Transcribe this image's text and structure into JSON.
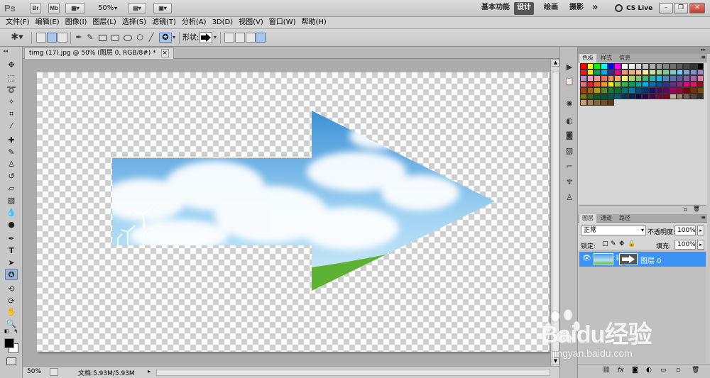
{
  "appbar": {
    "logo": "Ps",
    "br": "Br",
    "mb": "Mb",
    "zoom": "50%",
    "workspaces": [
      "基本功能",
      "设计",
      "绘画",
      "摄影"
    ],
    "active_workspace": "设计",
    "more": "»",
    "cslive": "CS Live"
  },
  "menu": [
    "文件(F)",
    "编辑(E)",
    "图像(I)",
    "图层(L)",
    "选择(S)",
    "滤镜(T)",
    "分析(A)",
    "3D(D)",
    "视图(V)",
    "窗口(W)",
    "帮助(H)"
  ],
  "options": {
    "shape_label": "形状:"
  },
  "document": {
    "tab_title": "timg (17).jpg @ 50% (图层 0, RGB/8#) *",
    "tab_close": "×"
  },
  "status": {
    "zoom": "50%",
    "doc_info": "文档:5.93M/5.93M"
  },
  "swatch_panel": {
    "tabs": [
      "色板",
      "样式",
      "信息"
    ],
    "active": "色板"
  },
  "layers_panel": {
    "tabs": [
      "图层",
      "通道",
      "路径"
    ],
    "active": "图层",
    "blend_mode": "正常",
    "opacity_label": "不透明度:",
    "opacity": "100%",
    "lock_label": "锁定:",
    "fill_label": "填充:",
    "fill": "100%",
    "layer_name": "图层 0"
  },
  "watermark": {
    "brand": "Baidu经验",
    "url": "jingyan.baidu.com"
  },
  "colors": {
    "selection": "#3c93f3",
    "active_workspace_bg": "#555555"
  }
}
